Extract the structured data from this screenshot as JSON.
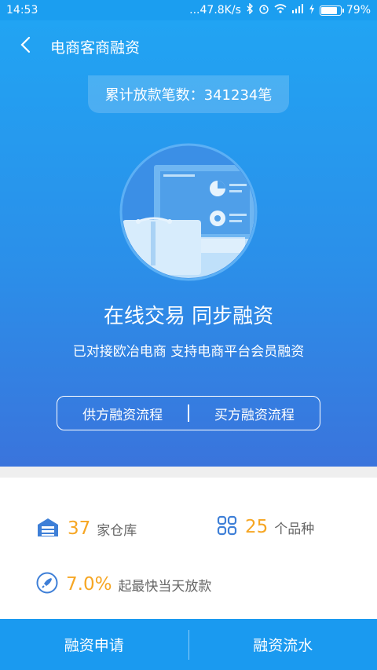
{
  "status_bar": {
    "time": "14:53",
    "network_speed": "...47.8K/s",
    "battery_percent": "79%",
    "battery_level": 0.79
  },
  "header": {
    "title": "电商客商融资"
  },
  "summary": {
    "total_loans": "累计放款笔数：341234笔"
  },
  "hero": {
    "headline": "在线交易 同步融资",
    "subline": "已对接欧冶电商 支持电商平台会员融资"
  },
  "flow": {
    "supplier_label": "供方融资流程",
    "buyer_label": "买方融资流程"
  },
  "stats": {
    "warehouses": {
      "value": "37",
      "unit": "家仓库"
    },
    "varieties": {
      "value": "25",
      "unit": "个品种"
    },
    "rate": {
      "value": "7.0%",
      "unit": "起最快当天放款"
    }
  },
  "bottom_bar": {
    "apply_label": "融资申请",
    "records_label": "融资流水"
  },
  "colors": {
    "primary": "#1b9ef0",
    "accent": "#f6a623",
    "icon_blue": "#3e7fd7"
  }
}
